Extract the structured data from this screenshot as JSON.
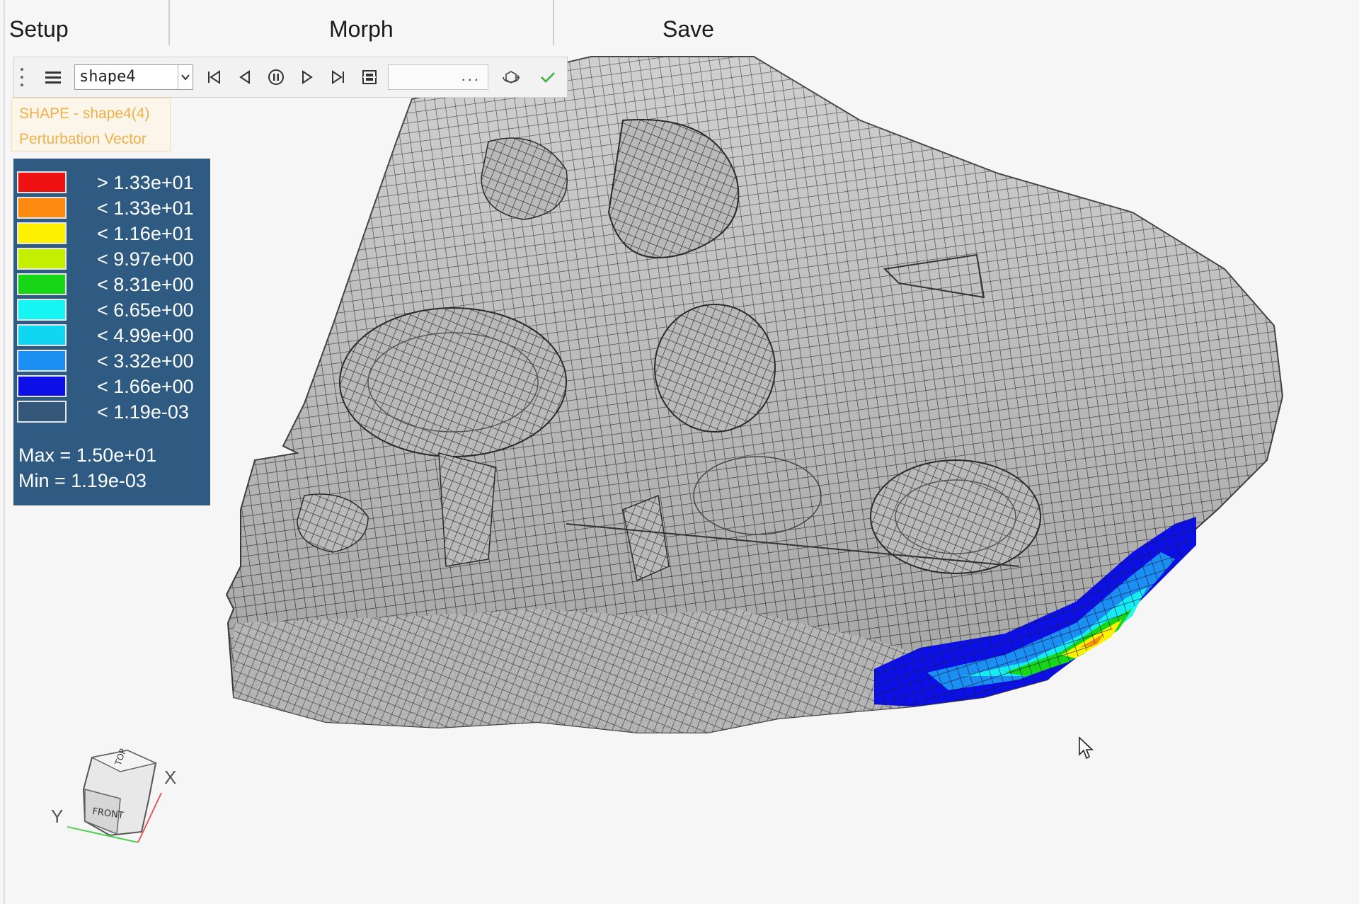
{
  "tabs": [
    {
      "label": "Setup"
    },
    {
      "label": "Morph"
    },
    {
      "label": "Save"
    }
  ],
  "toolbar": {
    "shape_value": "shape4",
    "frame_field_value": "...",
    "icons": [
      "grip-icon",
      "menu-icon",
      "dropdown-arrow-icon",
      "first-frame-icon",
      "previous-frame-icon",
      "pause-icon",
      "play-icon",
      "last-frame-icon",
      "film-icon",
      "rotate-view-icon",
      "apply-check-icon"
    ]
  },
  "shape_info": {
    "line1": "SHAPE - shape4(4)",
    "line2": "Perturbation Vector"
  },
  "legend": {
    "entries": [
      {
        "label": "> 1.33e+01",
        "color": "#ee1111"
      },
      {
        "label": "< 1.33e+01",
        "color": "#ff8a10"
      },
      {
        "label": "< 1.16e+01",
        "color": "#fff200"
      },
      {
        "label": "< 9.97e+00",
        "color": "#c4f000"
      },
      {
        "label": "< 8.31e+00",
        "color": "#16d616"
      },
      {
        "label": "< 6.65e+00",
        "color": "#17f5f2"
      },
      {
        "label": "< 4.99e+00",
        "color": "#10d6f2"
      },
      {
        "label": "< 3.32e+00",
        "color": "#1c8ff2"
      },
      {
        "label": "< 1.66e+00",
        "color": "#0d10e6"
      },
      {
        "label": "< 1.19e-03",
        "color": "#35587a"
      }
    ],
    "max": "Max = 1.50e+01",
    "min": "Min = 1.19e-03"
  },
  "view_cube": {
    "top_face": "TOP",
    "front_face": "FRONT"
  },
  "axes": {
    "x": "X",
    "y": "Y"
  }
}
